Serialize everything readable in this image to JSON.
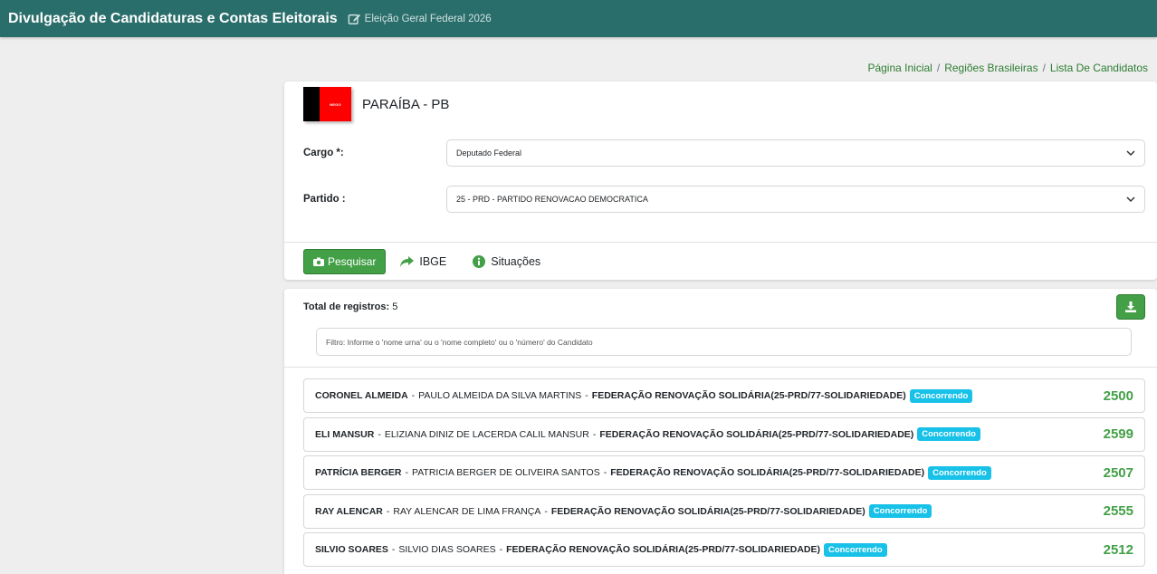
{
  "header": {
    "title": "Divulgação de Candidaturas e Contas Eleitorais",
    "election": "Eleição Geral Federal 2026"
  },
  "breadcrumb": [
    "Página Inicial",
    "Regiões Brasileiras",
    "Lista De Candidatos"
  ],
  "state": {
    "name": "PARAÍBA - PB",
    "flag_text": "NEGO"
  },
  "form": {
    "cargo_label": "Cargo *:",
    "cargo_value": "Deputado Federal",
    "partido_label": "Partido :",
    "partido_value": "25 - PRD - PARTIDO RENOVACAO DEMOCRATICA"
  },
  "actions": {
    "search": "Pesquisar",
    "ibge": "IBGE",
    "situacoes": "Situações"
  },
  "results": {
    "total_label": "Total de registros:",
    "total_value": "5",
    "filter_placeholder": "Filtro: Informe o 'nome urna' ou o 'nome completo' ou o 'número' do Candidato",
    "candidates": [
      {
        "urna": "CORONEL ALMEIDA",
        "full": "PAULO ALMEIDA DA SILVA MARTINS",
        "federation": "FEDERAÇÃO RENOVAÇÃO SOLIDÁRIA(25-PRD/77-SOLIDARIEDADE)",
        "status": "Concorrendo",
        "number": "2500"
      },
      {
        "urna": "ELI MANSUR",
        "full": "ELIZIANA DINIZ DE LACERDA CALIL MANSUR",
        "federation": "FEDERAÇÃO RENOVAÇÃO SOLIDÁRIA(25-PRD/77-SOLIDARIEDADE)",
        "status": "Concorrendo",
        "number": "2599"
      },
      {
        "urna": "PATRÍCIA BERGER",
        "full": "PATRICIA BERGER DE OLIVEIRA SANTOS",
        "federation": "FEDERAÇÃO RENOVAÇÃO SOLIDÁRIA(25-PRD/77-SOLIDARIEDADE)",
        "status": "Concorrendo",
        "number": "2507"
      },
      {
        "urna": "RAY ALENCAR",
        "full": "RAY ALENCAR DE LIMA FRANÇA",
        "federation": "FEDERAÇÃO RENOVAÇÃO SOLIDÁRIA(25-PRD/77-SOLIDARIEDADE)",
        "status": "Concorrendo",
        "number": "2555"
      },
      {
        "urna": "SILVIO SOARES",
        "full": "SILVIO DIAS SOARES",
        "federation": "FEDERAÇÃO RENOVAÇÃO SOLIDÁRIA(25-PRD/77-SOLIDARIEDADE)",
        "status": "Concorrendo",
        "number": "2512"
      }
    ]
  },
  "colors": {
    "topbar": "#2a6e6b",
    "accent_green": "#43a047",
    "badge": "#17c1e8"
  },
  "icons": {
    "edit": "edit-icon",
    "camera": "camera-icon",
    "share": "share-icon",
    "info": "info-icon",
    "download": "download-icon",
    "chevron": "chevron-down-icon"
  }
}
